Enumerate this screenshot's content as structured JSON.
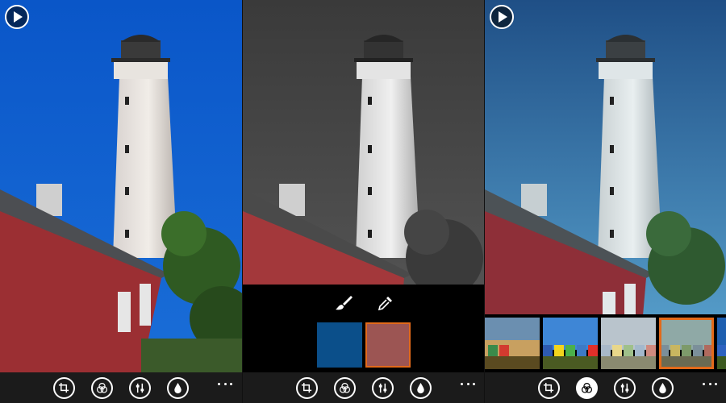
{
  "screens": [
    {
      "id": "original",
      "variant": "color",
      "has_play": true,
      "active_tool": null
    },
    {
      "id": "color-pop",
      "variant": "mono",
      "has_play": false,
      "active_tool": null
    },
    {
      "id": "filters",
      "variant": "cool",
      "has_play": true,
      "active_tool": "filters"
    }
  ],
  "appbar": {
    "buttons": [
      {
        "name": "crop-button",
        "icon": "crop-icon"
      },
      {
        "name": "filters-button",
        "icon": "filters-icon"
      },
      {
        "name": "adjust-button",
        "icon": "adjust-icon"
      },
      {
        "name": "color-button",
        "icon": "droplet-icon"
      }
    ],
    "more_icon": "more-icon"
  },
  "color_picker": {
    "tools": [
      "brush-icon",
      "eyedropper-icon"
    ],
    "swatches": [
      {
        "name": "blue-swatch",
        "color": "#0b4f8a",
        "selected": false
      },
      {
        "name": "red-swatch",
        "color": "#9c5553",
        "selected": true
      }
    ],
    "selected_border_color": "#e26a1a"
  },
  "filter_thumbnails": [
    {
      "name": "filter-thumb-1",
      "style": "warm",
      "selected": false
    },
    {
      "name": "filter-thumb-2",
      "style": "vivid",
      "selected": false
    },
    {
      "name": "filter-thumb-3",
      "style": "faded",
      "selected": false
    },
    {
      "name": "filter-thumb-4",
      "style": "vintage",
      "selected": true
    },
    {
      "name": "filter-thumb-5",
      "style": "cool",
      "selected": false
    }
  ],
  "colors": {
    "appbar_bg": "#1b1b1b",
    "accent": "#e26a1a",
    "sky_color": "#0a5bd1",
    "sky_mono": "#4a4a4a",
    "sky_cool": "#2f73b5",
    "barn_red": "#9b2f33"
  }
}
